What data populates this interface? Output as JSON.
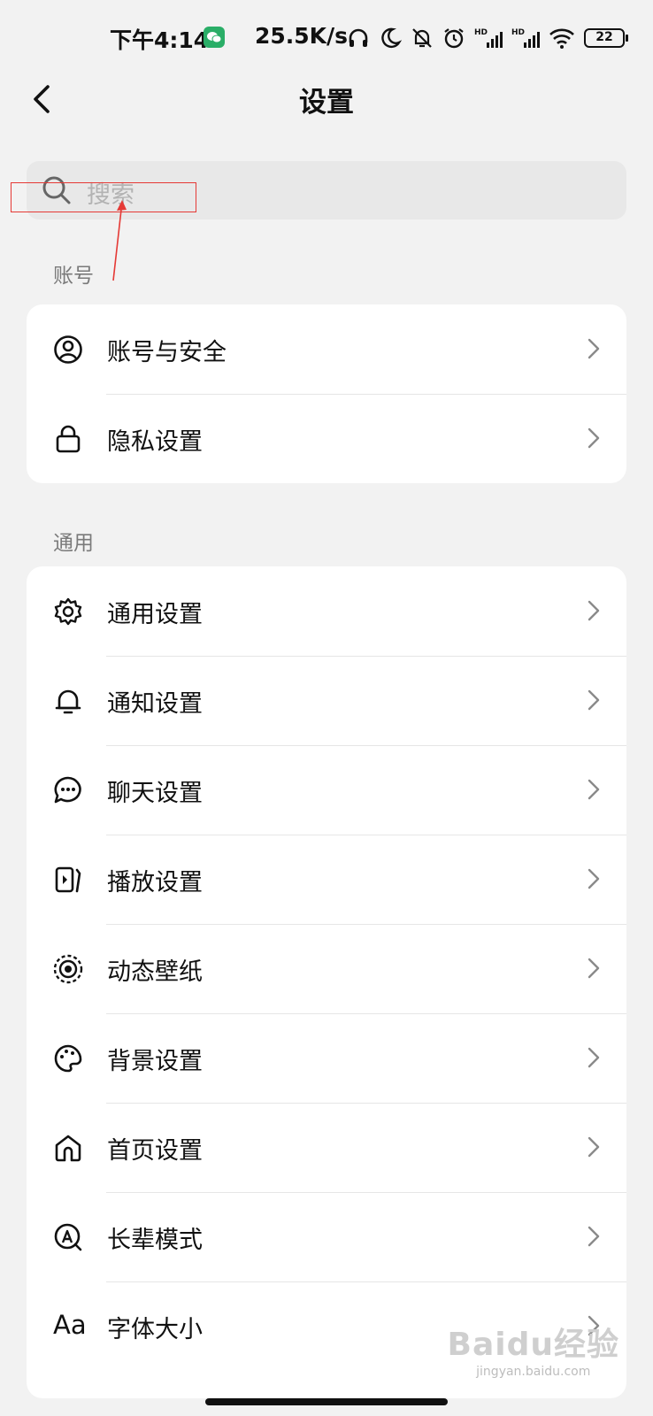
{
  "status_bar": {
    "time": "下午4:14",
    "network_speed": "25.5K/s",
    "battery": "22",
    "icons": [
      "wechat-icon",
      "headphones-icon",
      "moon-icon",
      "bell-off-icon",
      "alarm-icon",
      "hd-signal-icon",
      "hd-signal-icon",
      "wifi-icon",
      "battery-icon"
    ]
  },
  "nav": {
    "title": "设置",
    "back_icon": "chevron-left-icon"
  },
  "search": {
    "placeholder": "搜索"
  },
  "sections": {
    "account": {
      "header": "账号",
      "items": [
        {
          "label": "账号与安全",
          "icon": "user-circle-icon"
        },
        {
          "label": "隐私设置",
          "icon": "lock-icon"
        }
      ]
    },
    "general": {
      "header": "通用",
      "items": [
        {
          "label": "通用设置",
          "icon": "gear-icon"
        },
        {
          "label": "通知设置",
          "icon": "bell-icon"
        },
        {
          "label": "聊天设置",
          "icon": "chat-bubble-icon"
        },
        {
          "label": "播放设置",
          "icon": "play-icon"
        },
        {
          "label": "动态壁纸",
          "icon": "live-wallpaper-icon"
        },
        {
          "label": "背景设置",
          "icon": "palette-icon"
        },
        {
          "label": "首页设置",
          "icon": "home-icon"
        },
        {
          "label": "长辈模式",
          "icon": "elder-mode-icon"
        },
        {
          "label": "字体大小",
          "icon_text": "Aa",
          "icon": "font-size-icon"
        }
      ]
    }
  },
  "watermark": {
    "logo": "Baidu经验",
    "url": "jingyan.baidu.com"
  },
  "colors": {
    "background": "#f2f2f2",
    "card": "#ffffff",
    "annotation": "#e53935",
    "wechat": "#2aae67"
  }
}
